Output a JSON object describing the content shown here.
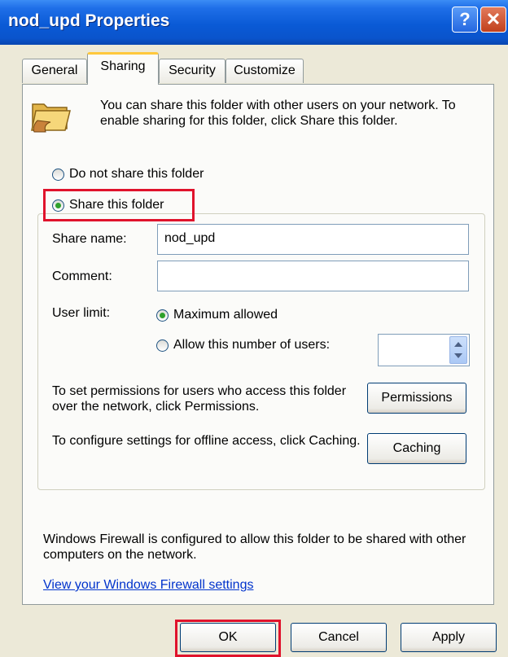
{
  "window": {
    "title": "nod_upd Properties"
  },
  "tabs": [
    {
      "label": "General"
    },
    {
      "label": "Sharing"
    },
    {
      "label": "Security"
    },
    {
      "label": "Customize"
    }
  ],
  "intro_text": "You can share this folder with other users on your network.  To enable sharing for this folder, click Share this folder.",
  "radios": {
    "do_not_share": "Do not share this folder",
    "share": "Share this folder"
  },
  "share_name": {
    "label": "Share name:",
    "value": "nod_upd"
  },
  "comment": {
    "label": "Comment:",
    "value": ""
  },
  "user_limit": {
    "label": "User limit:",
    "max_allowed": "Maximum allowed",
    "allow_number": "Allow this number of users:"
  },
  "permissions": {
    "text": "To set permissions for users who access this folder over the network, click Permissions.",
    "button": "Permissions"
  },
  "caching": {
    "text": "To configure settings for offline access, click Caching.",
    "button": "Caching"
  },
  "firewall": {
    "text": "Windows Firewall is configured to allow this folder to be shared with other computers on the network.",
    "link": "View your Windows Firewall settings"
  },
  "buttons": {
    "ok": "OK",
    "cancel": "Cancel",
    "apply": "Apply"
  },
  "colors": {
    "highlight": "#e0132c",
    "title_bar": "#0a5ad6",
    "radio_dot": "#2fa12b"
  }
}
